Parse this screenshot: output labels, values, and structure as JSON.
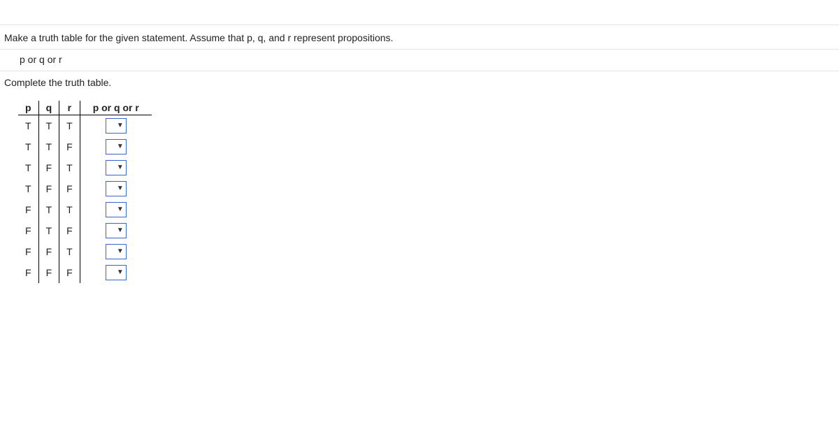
{
  "instruction": "Make a truth table for the given statement. Assume that p, q, and r represent propositions.",
  "expression": "p or q or r",
  "complete_label": "Complete the truth table.",
  "table": {
    "headers": [
      "p",
      "q",
      "r",
      "p or q or r"
    ],
    "rows": [
      {
        "p": "T",
        "q": "T",
        "r": "T"
      },
      {
        "p": "T",
        "q": "T",
        "r": "F"
      },
      {
        "p": "T",
        "q": "F",
        "r": "T"
      },
      {
        "p": "T",
        "q": "F",
        "r": "F"
      },
      {
        "p": "F",
        "q": "T",
        "r": "T"
      },
      {
        "p": "F",
        "q": "T",
        "r": "F"
      },
      {
        "p": "F",
        "q": "F",
        "r": "T"
      },
      {
        "p": "F",
        "q": "F",
        "r": "F"
      }
    ]
  }
}
